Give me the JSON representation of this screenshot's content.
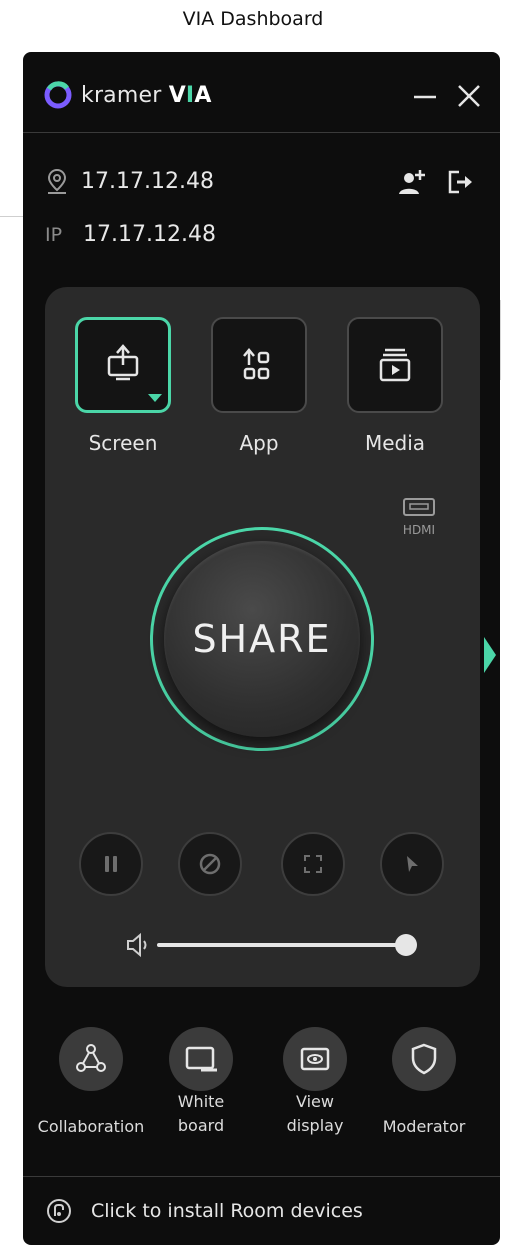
{
  "page": {
    "title": "VIA Dashboard"
  },
  "app": {
    "brand": "kramer",
    "product_v": "V",
    "product_i": "I",
    "product_a": "A",
    "accent": "#4bd6a8"
  },
  "connection": {
    "location_value": "17.17.12.48",
    "ip_label": "IP",
    "ip_value": "17.17.12.48"
  },
  "sources": [
    {
      "label": "Screen",
      "icon": "screen-share-icon",
      "active": true
    },
    {
      "label": "App",
      "icon": "app-share-icon",
      "active": false
    },
    {
      "label": "Media",
      "icon": "media-share-icon",
      "active": false
    }
  ],
  "hdmi_label": "HDMI",
  "share_label": "SHARE",
  "controls": [
    "pause-icon",
    "stop-icon",
    "fullscreen-icon",
    "pointer-icon"
  ],
  "volume": {
    "level": 0.95
  },
  "tools": [
    {
      "label_1": "Collaboration",
      "label_2": "",
      "icon": "collaboration-icon"
    },
    {
      "label_1": "White",
      "label_2": "board",
      "icon": "whiteboard-icon"
    },
    {
      "label_1": "View",
      "label_2": "display",
      "icon": "view-display-icon"
    },
    {
      "label_1": "Moderator",
      "label_2": "",
      "icon": "moderator-icon"
    }
  ],
  "footer": {
    "text": "Click to install Room devices"
  }
}
